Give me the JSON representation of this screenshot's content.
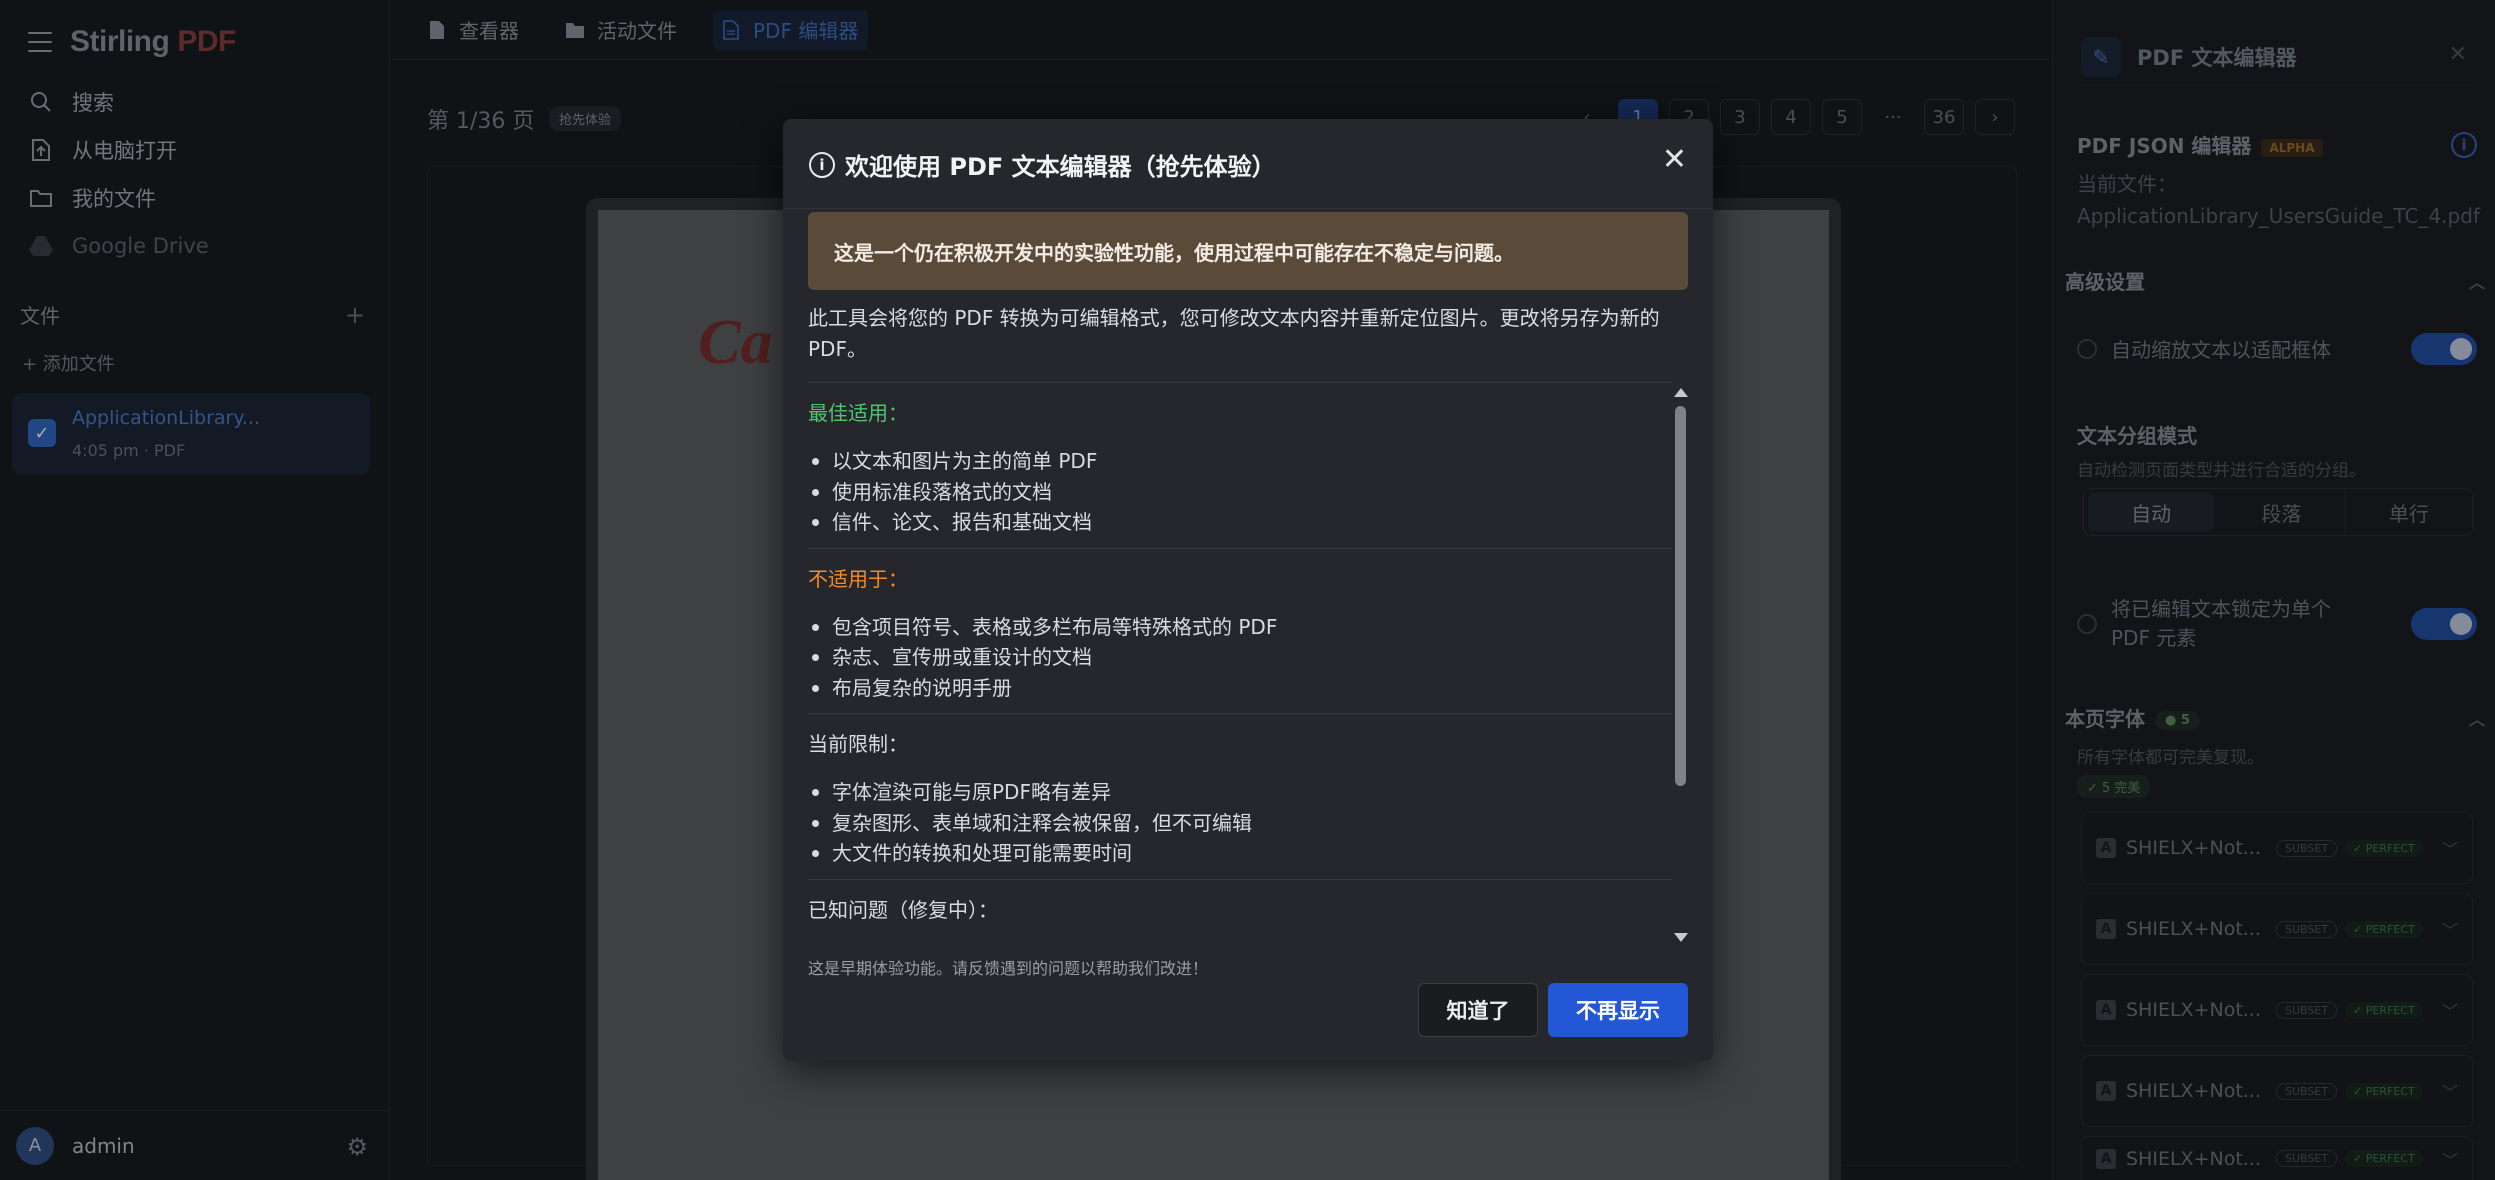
{
  "app": {
    "logo_main": "Stirling",
    "logo_accent": "PDF"
  },
  "sidebar": {
    "nav": [
      {
        "label": "搜索",
        "icon": "search-icon"
      },
      {
        "label": "从电脑打开",
        "icon": "upload-file-icon"
      },
      {
        "label": "我的文件",
        "icon": "folder-icon"
      },
      {
        "label": "Google Drive",
        "icon": "google-drive-icon"
      }
    ],
    "files_label": "文件",
    "add_files_label": "+ 添加文件",
    "file": {
      "name": "ApplicationLibrary...",
      "meta": "4:05 pm · PDF"
    },
    "user": {
      "initial": "A",
      "name": "admin"
    }
  },
  "tabs": [
    {
      "label": "查看器",
      "icon": "file-icon"
    },
    {
      "label": "活动文件",
      "icon": "folder-icon"
    },
    {
      "label": "PDF 编辑器",
      "icon": "document-icon",
      "active": true
    }
  ],
  "viewer": {
    "page_label": "第 1/36 页",
    "badge": "抢先体验",
    "pages": [
      "1",
      "2",
      "3",
      "4",
      "5",
      "···",
      "36"
    ],
    "current_page": "1",
    "pdf_logo": "Ca"
  },
  "right_panel": {
    "title": "PDF 文本编辑器",
    "json_title": "PDF JSON 编辑器",
    "alpha": "ALPHA",
    "current_file_label": "当前文件：",
    "current_file": "ApplicationLibrary_UsersGuide_TC_4.pdf",
    "advanced": "高级设置",
    "autoscale": "自动缩放文本以适配框体",
    "grouping_title": "文本分组模式",
    "grouping_desc": "自动检测页面类型并进行合适的分组。",
    "grouping_options": [
      "自动",
      "段落",
      "单行"
    ],
    "grouping_selected": "自动",
    "lock_text": "将已编辑文本锁定为单个 PDF 元素",
    "fonts_title": "本页字体",
    "fonts_count": "● 5",
    "fonts_desc": "所有字体都可完美复现。",
    "fonts_ok": "✓ 5 完美",
    "fonts": [
      {
        "name": "SHIELX+Not...",
        "subset": "SUBSET",
        "status": "✓ PERFECT"
      },
      {
        "name": "SHIELX+Not...",
        "subset": "SUBSET",
        "status": "✓ PERFECT"
      },
      {
        "name": "SHIELX+Not...",
        "subset": "SUBSET",
        "status": "✓ PERFECT"
      },
      {
        "name": "SHIELX+Not...",
        "subset": "SUBSET",
        "status": "✓ PERFECT"
      },
      {
        "name": "SHIELX+Not...",
        "subset": "SUBSET",
        "status": "✓ PERFECT"
      }
    ]
  },
  "modal": {
    "title": "欢迎使用 PDF 文本编辑器（抢先体验）",
    "warning": "这是一个仍在积极开发中的实验性功能，使用过程中可能存在不稳定与问题。",
    "intro": "此工具会将您的 PDF 转换为可编辑格式，您可修改文本内容并重新定位图片。更改将另存为新的 PDF。",
    "best_title": "最佳适用：",
    "best_items": [
      "以文本和图片为主的简单 PDF",
      "使用标准段落格式的文档",
      "信件、论文、报告和基础文档"
    ],
    "not_title": "不适用于：",
    "not_items": [
      "包含项目符号、表格或多栏布局等特殊格式的 PDF",
      "杂志、宣传册或重设计的文档",
      "布局复杂的说明手册"
    ],
    "limits_title": "当前限制：",
    "limits_items": [
      "字体渲染可能与原PDF略有差异",
      "复杂图形、表单域和注释会被保留，但不可编辑",
      "大文件的转换和处理可能需要时间"
    ],
    "known_title": "已知问题（修复中）：",
    "footnote": "这是早期体验功能。请反馈遇到的问题以帮助我们改进！",
    "btn_ok": "知道了",
    "btn_dismiss": "不再显示"
  }
}
